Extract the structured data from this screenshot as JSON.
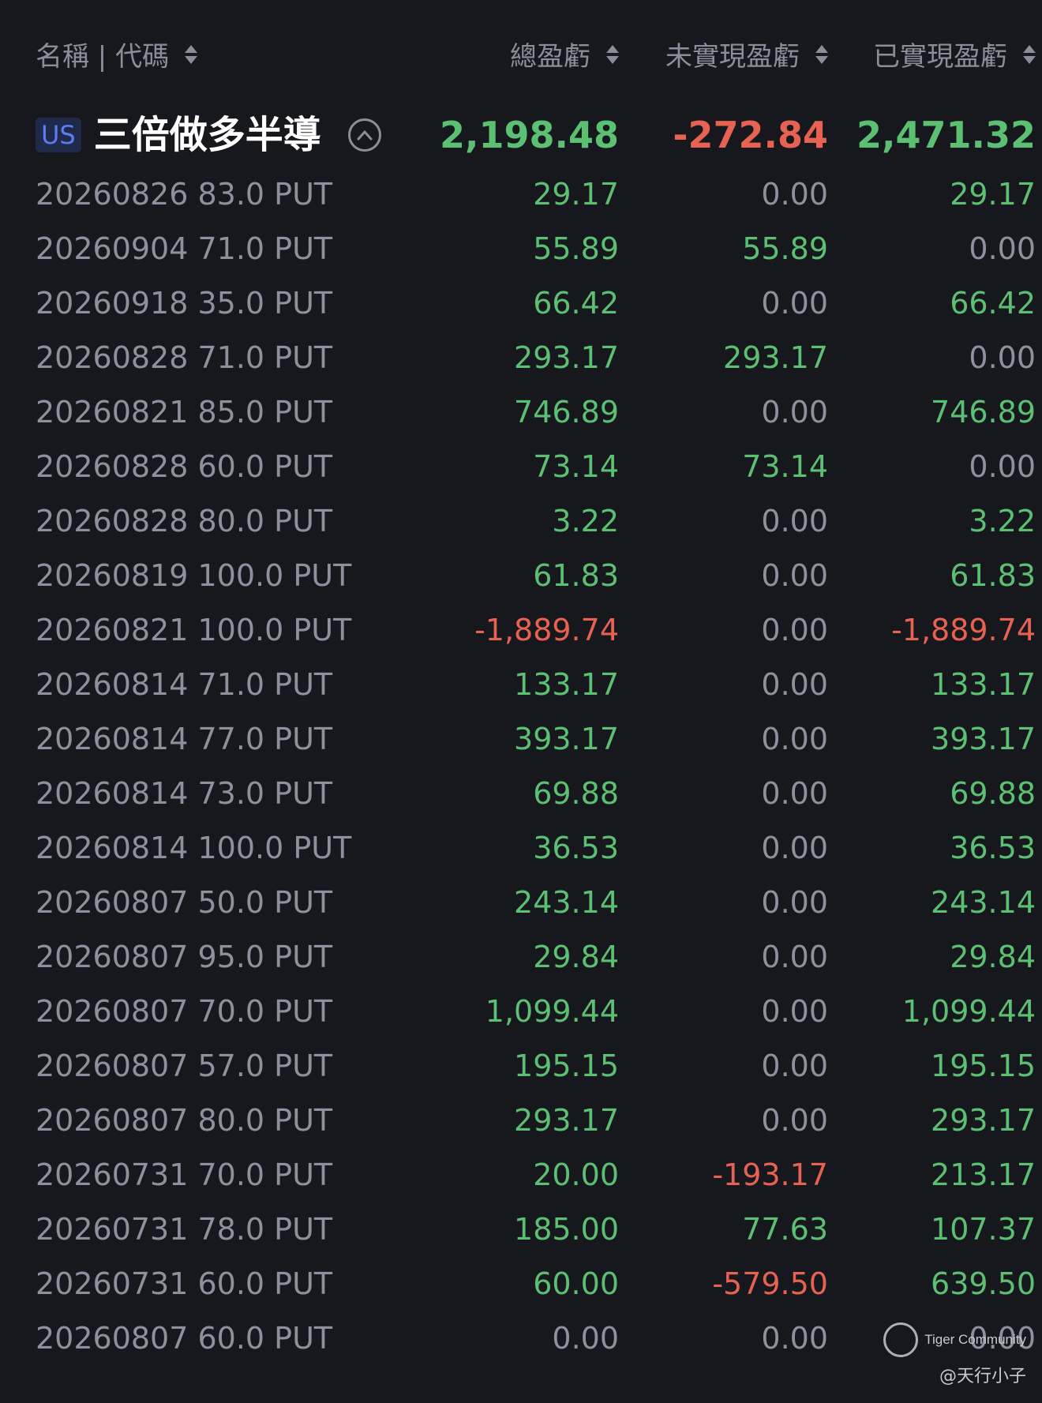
{
  "header": {
    "name_label": "名稱 | 代碼",
    "total_label": "總盈虧",
    "unrealized_label": "未實現盈虧",
    "realized_label": "已實現盈虧"
  },
  "group": {
    "market": "US",
    "name": "三倍做多半導",
    "total": "2,198.48",
    "unrealized": "-272.84",
    "realized": "2,471.32"
  },
  "rows": [
    {
      "name": "20260826 83.0 PUT",
      "total": "29.17",
      "unrealized": "0.00",
      "realized": "29.17"
    },
    {
      "name": "20260904 71.0 PUT",
      "total": "55.89",
      "unrealized": "55.89",
      "realized": "0.00"
    },
    {
      "name": "20260918 35.0 PUT",
      "total": "66.42",
      "unrealized": "0.00",
      "realized": "66.42"
    },
    {
      "name": "20260828 71.0 PUT",
      "total": "293.17",
      "unrealized": "293.17",
      "realized": "0.00"
    },
    {
      "name": "20260821 85.0 PUT",
      "total": "746.89",
      "unrealized": "0.00",
      "realized": "746.89"
    },
    {
      "name": "20260828 60.0 PUT",
      "total": "73.14",
      "unrealized": "73.14",
      "realized": "0.00"
    },
    {
      "name": "20260828 80.0 PUT",
      "total": "3.22",
      "unrealized": "0.00",
      "realized": "3.22"
    },
    {
      "name": "20260819 100.0 PUT",
      "total": "61.83",
      "unrealized": "0.00",
      "realized": "61.83"
    },
    {
      "name": "20260821 100.0 PUT",
      "total": "-1,889.74",
      "unrealized": "0.00",
      "realized": "-1,889.74"
    },
    {
      "name": "20260814 71.0 PUT",
      "total": "133.17",
      "unrealized": "0.00",
      "realized": "133.17"
    },
    {
      "name": "20260814 77.0 PUT",
      "total": "393.17",
      "unrealized": "0.00",
      "realized": "393.17"
    },
    {
      "name": "20260814 73.0 PUT",
      "total": "69.88",
      "unrealized": "0.00",
      "realized": "69.88"
    },
    {
      "name": "20260814 100.0 PUT",
      "total": "36.53",
      "unrealized": "0.00",
      "realized": "36.53"
    },
    {
      "name": "20260807 50.0 PUT",
      "total": "243.14",
      "unrealized": "0.00",
      "realized": "243.14"
    },
    {
      "name": "20260807 95.0 PUT",
      "total": "29.84",
      "unrealized": "0.00",
      "realized": "29.84"
    },
    {
      "name": "20260807 70.0 PUT",
      "total": "1,099.44",
      "unrealized": "0.00",
      "realized": "1,099.44"
    },
    {
      "name": "20260807 57.0 PUT",
      "total": "195.15",
      "unrealized": "0.00",
      "realized": "195.15"
    },
    {
      "name": "20260807 80.0 PUT",
      "total": "293.17",
      "unrealized": "0.00",
      "realized": "293.17"
    },
    {
      "name": "20260731 70.0 PUT",
      "total": "20.00",
      "unrealized": "-193.17",
      "realized": "213.17"
    },
    {
      "name": "20260731 78.0 PUT",
      "total": "185.00",
      "unrealized": "77.63",
      "realized": "107.37"
    },
    {
      "name": "20260731 60.0 PUT",
      "total": "60.00",
      "unrealized": "-579.50",
      "realized": "639.50"
    },
    {
      "name": "20260807 60.0 PUT",
      "total": "0.00",
      "unrealized": "0.00",
      "realized": "0.00"
    }
  ],
  "colors": {
    "positive": "#5cc072",
    "negative": "#e86252",
    "zero": "#8f909e"
  },
  "watermark": {
    "brand": "Tiger Community",
    "handle": "@天行小子",
    "icon": "tiger-logo-icon"
  }
}
